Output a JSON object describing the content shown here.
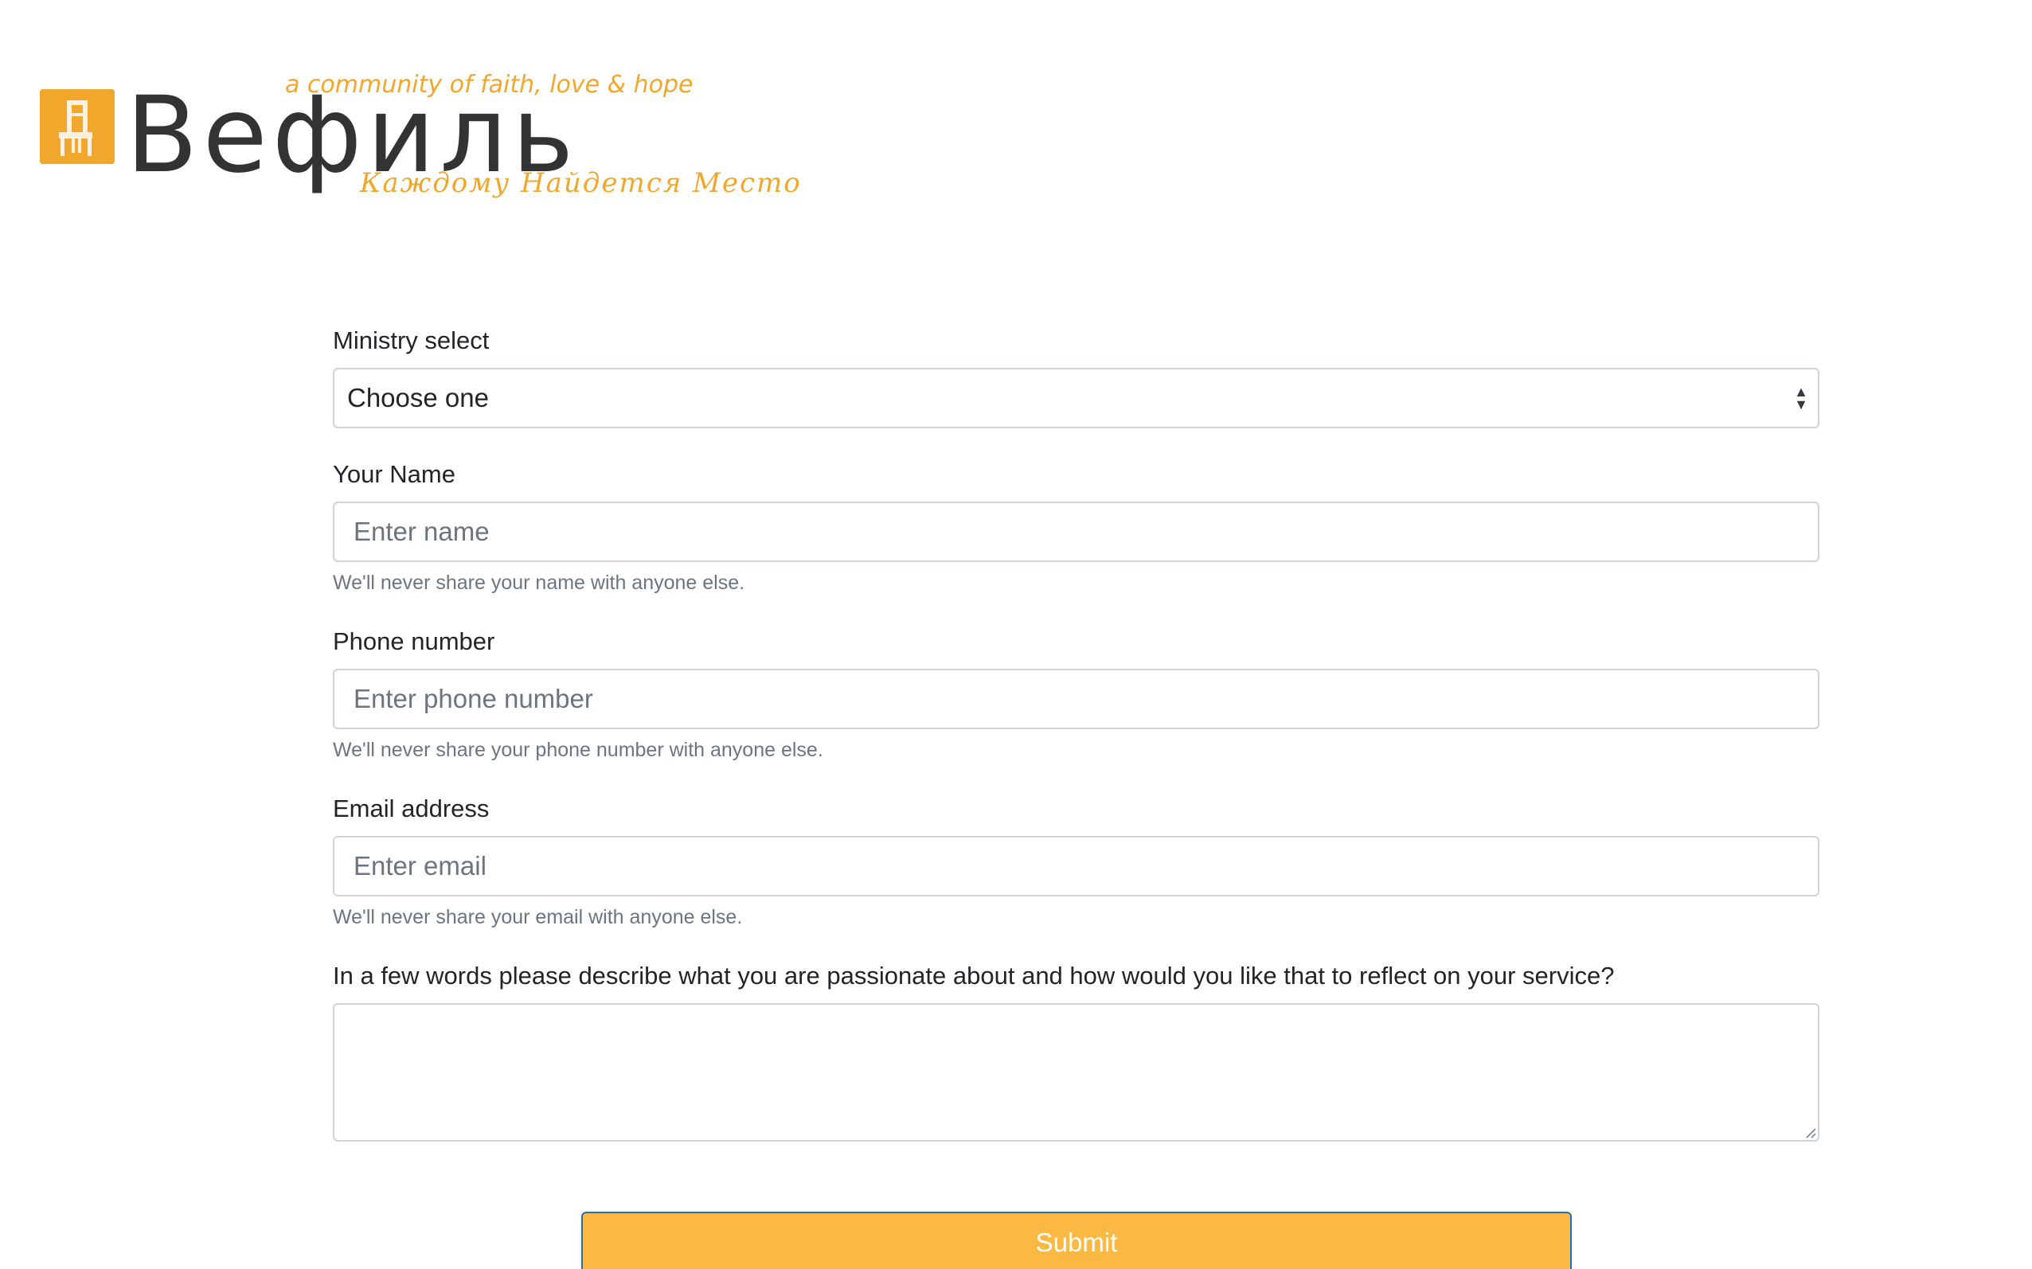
{
  "logo": {
    "wordmark": "Вефиль",
    "tagline_en": "a community of faith, love & hope",
    "tagline_ru": "Каждому Найдется Место",
    "brand_color": "#f0a72c",
    "icon": "chair-icon"
  },
  "form": {
    "ministry": {
      "label": "Ministry select",
      "selected": "Choose one"
    },
    "name": {
      "label": "Your Name",
      "placeholder": "Enter name",
      "help": "We'll never share your name with anyone else."
    },
    "phone": {
      "label": "Phone number",
      "placeholder": "Enter phone number",
      "help": "We'll never share your phone number with anyone else."
    },
    "email": {
      "label": "Email address",
      "placeholder": "Enter email",
      "help": "We'll never share your email with anyone else."
    },
    "passion": {
      "label": "In a few words please describe what you are passionate about and how would you like that to reflect on your service?",
      "value": ""
    },
    "submit_label": "Submit",
    "submit_color": "#fbb843"
  }
}
